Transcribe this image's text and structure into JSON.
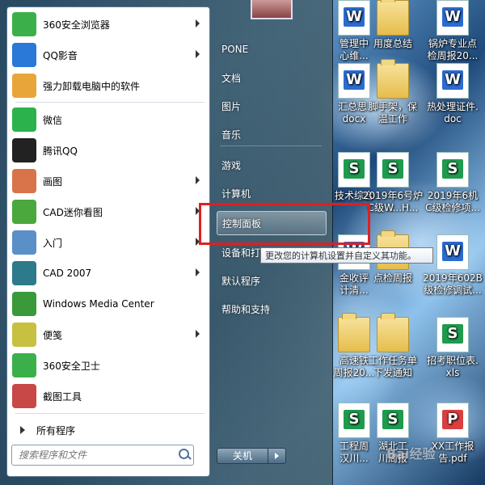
{
  "programs": [
    {
      "label": "360安全浏览器",
      "icon": "360-browser-icon",
      "color": "#3bb04a",
      "has_arrow": true
    },
    {
      "label": "QQ影音",
      "icon": "qq-player-icon",
      "color": "#2a78d8",
      "has_arrow": true
    },
    {
      "label": "强力卸载电脑中的软件",
      "icon": "uninstaller-icon",
      "color": "#e8a63a",
      "has_arrow": false
    },
    {
      "label": "微信",
      "icon": "wechat-icon",
      "color": "#2bb24c",
      "has_arrow": false
    },
    {
      "label": "腾讯QQ",
      "icon": "qq-penguin-icon",
      "color": "#222222",
      "has_arrow": false
    },
    {
      "label": "画图",
      "icon": "paint-icon",
      "color": "#d9734a",
      "has_arrow": true
    },
    {
      "label": "CAD迷你看图",
      "icon": "cad-viewer-icon",
      "color": "#4aa83c",
      "has_arrow": true
    },
    {
      "label": "入门",
      "icon": "getting-started-icon",
      "color": "#5a8fc8",
      "has_arrow": true
    },
    {
      "label": "CAD 2007",
      "icon": "cad-2007-icon",
      "color": "#2d7a8a",
      "has_arrow": true
    },
    {
      "label": "Windows Media Center",
      "icon": "media-center-icon",
      "color": "#3a9a3a",
      "has_arrow": false
    },
    {
      "label": "便笺",
      "icon": "sticky-notes-icon",
      "color": "#c8c040",
      "has_arrow": true
    },
    {
      "label": "360安全卫士",
      "icon": "360-safe-icon",
      "color": "#3bb04a",
      "has_arrow": false
    },
    {
      "label": "截图工具",
      "icon": "snipping-tool-icon",
      "color": "#c84848",
      "has_arrow": false
    }
  ],
  "all_programs_label": "所有程序",
  "search": {
    "placeholder": "搜索程序和文件"
  },
  "right_items": [
    {
      "label": "PONE"
    },
    {
      "label": "文档"
    },
    {
      "label": "图片"
    },
    {
      "label": "音乐"
    },
    {
      "label": "游戏"
    },
    {
      "label": "计算机"
    },
    {
      "label": "控制面板"
    },
    {
      "label": "设备和打"
    },
    {
      "label": "默认程序"
    },
    {
      "label": "帮助和支持"
    }
  ],
  "tooltip": "更改您的计算机设置并自定义其功能。",
  "shutdown_label": "关机",
  "desktop_icons": [
    {
      "label1": "管理中",
      "label2": "心维...",
      "type": "doc",
      "glyph": "W"
    },
    {
      "label1": "用度总结",
      "label2": "",
      "type": "folder",
      "glyph": ""
    },
    {
      "label1": "锅炉专业点",
      "label2": "检周报20...",
      "type": "doc",
      "glyph": "W"
    },
    {
      "label1": "汇总思.",
      "label2": "docx",
      "type": "doc",
      "glyph": "W"
    },
    {
      "label1": "脚手架，保",
      "label2": "温工作",
      "type": "folder",
      "glyph": ""
    },
    {
      "label1": "热处理证件.",
      "label2": "doc",
      "type": "doc",
      "glyph": "W"
    },
    {
      "label1": "技术综合",
      "label2": "",
      "type": "xls",
      "glyph": "S"
    },
    {
      "label1": "2019年6号炉",
      "label2": "C级W...H...",
      "type": "xls",
      "glyph": "S"
    },
    {
      "label1": "2019年6机",
      "label2": "C级检修项...",
      "type": "xls",
      "glyph": "S"
    },
    {
      "label1": "金收评",
      "label2": "计清...",
      "type": "doc",
      "glyph": "W"
    },
    {
      "label1": "点检周报",
      "label2": "",
      "type": "folder",
      "glyph": ""
    },
    {
      "label1": "2019年602B",
      "label2": "级检修调试...",
      "type": "doc",
      "glyph": "W"
    },
    {
      "label1": "高速铁",
      "label2": "周报20...",
      "type": "folder",
      "glyph": ""
    },
    {
      "label1": "工作任务单",
      "label2": "下发通知",
      "type": "folder",
      "glyph": ""
    },
    {
      "label1": "招考职位表.",
      "label2": "xls",
      "type": "xls",
      "glyph": "S"
    },
    {
      "label1": "工程周",
      "label2": "汉川...",
      "type": "xls",
      "glyph": "S"
    },
    {
      "label1": "湖北工",
      "label2": "川周报",
      "type": "xls",
      "glyph": "S"
    },
    {
      "label1": "XX工作报",
      "label2": "告.pdf",
      "type": "pdf",
      "glyph": "P"
    }
  ],
  "watermark": "Bai经验"
}
